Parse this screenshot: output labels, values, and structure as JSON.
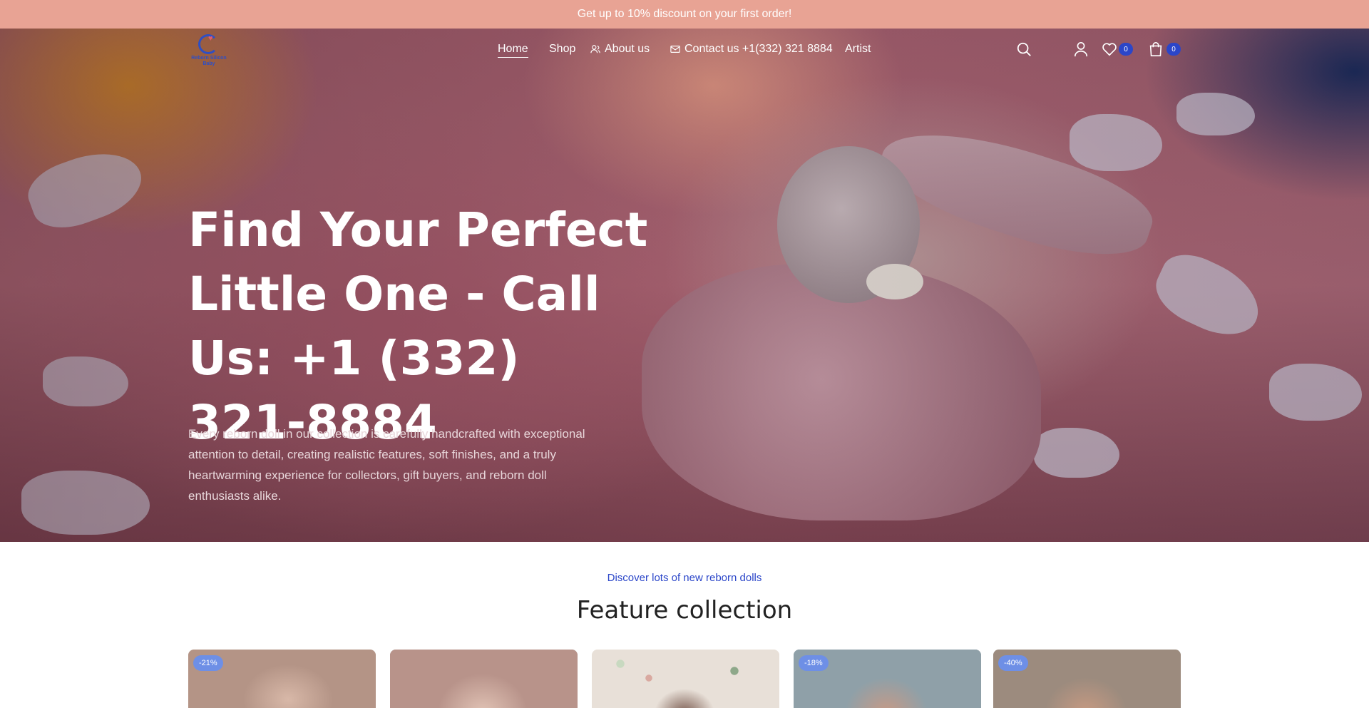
{
  "announcement": {
    "text": "Get up to 10% discount on your first order!"
  },
  "brand": {
    "logo_text": "Reborn Silicon Baby"
  },
  "nav": {
    "items": [
      {
        "label": "Home",
        "icon": "",
        "active": true
      },
      {
        "label": "Shop",
        "icon": ""
      },
      {
        "label": "About us",
        "icon": "user-icon"
      },
      {
        "label": "Contact us +1(332) 321 8884",
        "icon": "mail-icon"
      },
      {
        "label": "Artist",
        "icon": ""
      }
    ],
    "tools": {
      "search_icon": "search-icon",
      "account_icon": "user-icon",
      "wishlist_icon": "heart-icon",
      "wishlist_count": "0",
      "cart_icon": "bag-icon",
      "cart_count": "0"
    }
  },
  "hero": {
    "title": "Find Your Perfect Little One - Call Us: +1 (332) 321-8884",
    "text": "Every reborn doll in our collection is carefully handcrafted with exceptional attention to detail, creating realistic features, soft finishes, and a truly heartwarming experience for collectors, gift buyers, and reborn doll enthusiasts alike."
  },
  "collection": {
    "kicker": "Discover lots of new reborn dolls",
    "title": "Feature collection",
    "cards": [
      {
        "badge": "-21%"
      },
      {
        "badge": ""
      },
      {
        "badge": ""
      },
      {
        "badge": "-18%"
      },
      {
        "badge": "-40%"
      }
    ]
  },
  "colors": {
    "announcement_bg": "#e8a394",
    "accent": "#2b46c9",
    "badge_bg": "#6e8fe6"
  }
}
